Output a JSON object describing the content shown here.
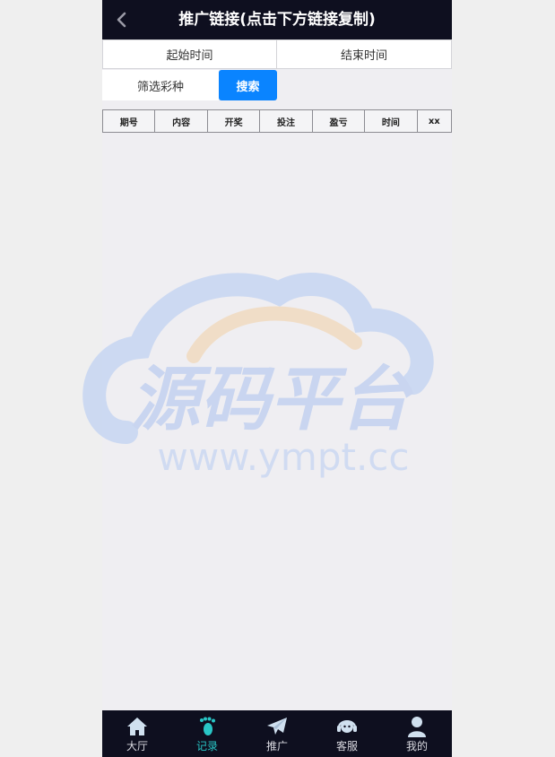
{
  "header": {
    "title": "推广链接(点击下方链接复制)",
    "back_icon": "chevron-left-icon"
  },
  "dates": {
    "start_label": "起始时间",
    "end_label": "结束时间"
  },
  "filter": {
    "lottery_label": "筛选彩种",
    "search_label": "搜索",
    "accent": "#0a84ff"
  },
  "table": {
    "columns": [
      "期号",
      "内容",
      "开奖",
      "投注",
      "盈亏",
      "时间",
      "xx"
    ],
    "rows": []
  },
  "watermark": {
    "text_cn": "源码平台",
    "text_url": "www.ympt.cc"
  },
  "nav": {
    "items": [
      {
        "label": "大厅",
        "icon": "home-icon"
      },
      {
        "label": "记录",
        "icon": "footprint-icon"
      },
      {
        "label": "推广",
        "icon": "paper-plane-icon"
      },
      {
        "label": "客服",
        "icon": "headset-icon"
      },
      {
        "label": "我的",
        "icon": "user-icon"
      }
    ],
    "active_index": 1,
    "active_color": "#29c6c6"
  }
}
